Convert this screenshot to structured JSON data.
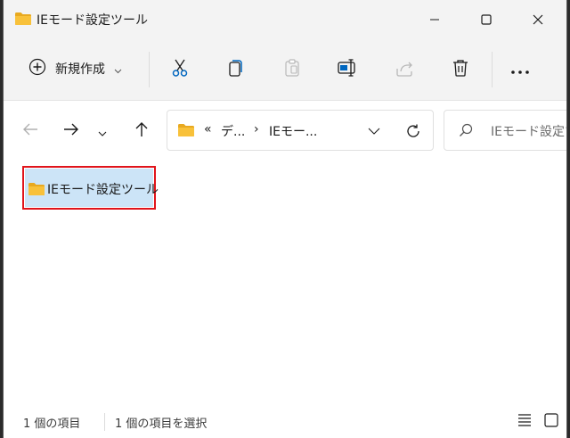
{
  "window": {
    "title": "IEモード設定ツール"
  },
  "toolbar": {
    "new_label": "新規作成",
    "icons": [
      "cut-icon",
      "copy-icon",
      "paste-icon",
      "rename-icon",
      "share-icon",
      "delete-icon",
      "more-icon"
    ]
  },
  "nav": {
    "address": {
      "overflow": "«",
      "crumb1": "デ...",
      "separator": "›",
      "crumb2": "IEモー..."
    },
    "search_placeholder": "IEモード設定ツ"
  },
  "content": {
    "items": [
      {
        "name": "IEモード設定ツール",
        "selected": true
      }
    ]
  },
  "status": {
    "item_count": "1 個の項目",
    "selected_count": "1 個の項目を選択"
  },
  "colors": {
    "folder": "#f8c13a",
    "selection": "#cce4f7",
    "highlight_border": "#e0141b",
    "accent": "#0067c0"
  }
}
